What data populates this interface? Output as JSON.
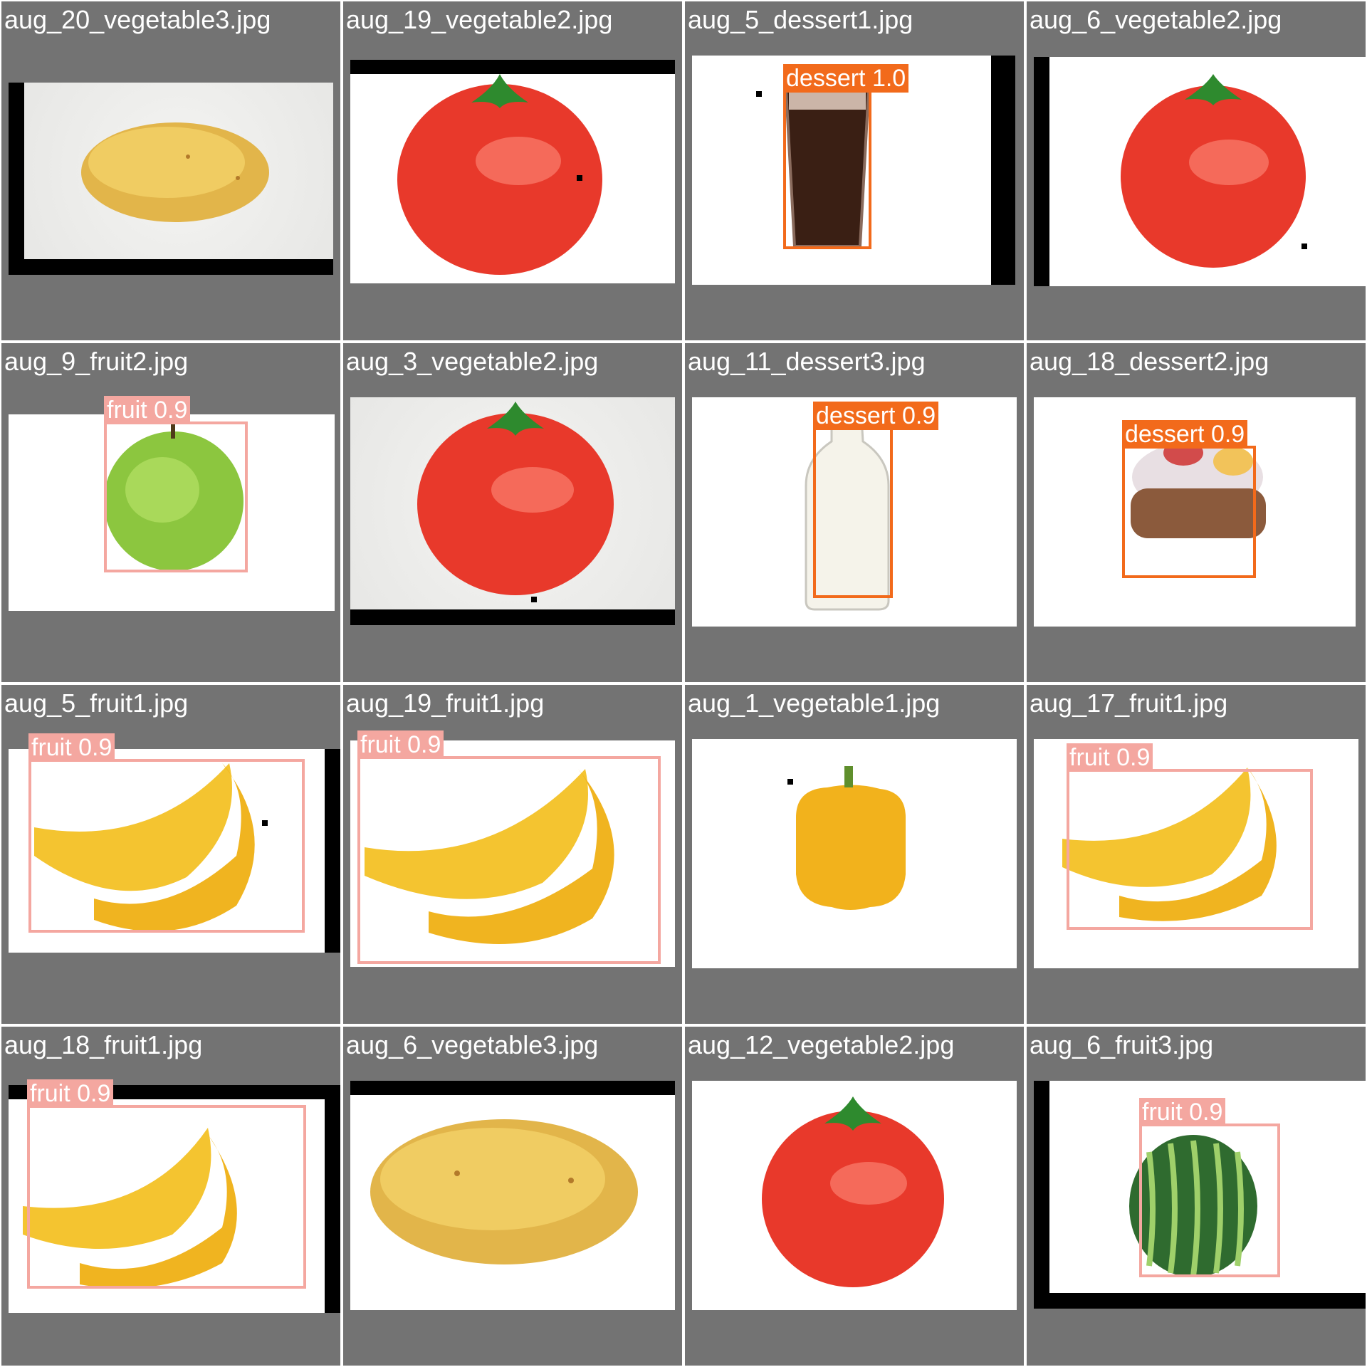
{
  "colors": {
    "panel_bg": "#737373",
    "fruit_box": "#f4a7a0",
    "dessert_box": "#f26a1b",
    "black_border": "#000000",
    "title_text": "#ffffff"
  },
  "tiles": [
    {
      "filename": "aug_20_vegetable3.jpg",
      "object": "potato",
      "detections": []
    },
    {
      "filename": "aug_19_vegetable2.jpg",
      "object": "tomato",
      "detections": []
    },
    {
      "filename": "aug_5_dessert1.jpg",
      "object": "cola-glass",
      "detections": [
        {
          "label": "dessert 1.0",
          "class": "dessert",
          "score": 1.0
        }
      ]
    },
    {
      "filename": "aug_6_vegetable2.jpg",
      "object": "tomato",
      "detections": []
    },
    {
      "filename": "aug_9_fruit2.jpg",
      "object": "green-apple",
      "detections": [
        {
          "label": "fruit 0.9",
          "class": "fruit",
          "score": 0.9
        }
      ]
    },
    {
      "filename": "aug_3_vegetable2.jpg",
      "object": "tomato",
      "detections": []
    },
    {
      "filename": "aug_11_dessert3.jpg",
      "object": "milk-bottle",
      "detections": [
        {
          "label": "dessert 0.9",
          "class": "dessert",
          "score": 0.9
        }
      ]
    },
    {
      "filename": "aug_18_dessert2.jpg",
      "object": "cupcake",
      "detections": [
        {
          "label": "dessert 0.9",
          "class": "dessert",
          "score": 0.9
        }
      ]
    },
    {
      "filename": "aug_5_fruit1.jpg",
      "object": "banana-bunch",
      "detections": [
        {
          "label": "fruit 0.9",
          "class": "fruit",
          "score": 0.9
        }
      ]
    },
    {
      "filename": "aug_19_fruit1.jpg",
      "object": "banana-bunch",
      "detections": [
        {
          "label": "fruit 0.9",
          "class": "fruit",
          "score": 0.9
        }
      ]
    },
    {
      "filename": "aug_1_vegetable1.jpg",
      "object": "yellow-pepper",
      "detections": []
    },
    {
      "filename": "aug_17_fruit1.jpg",
      "object": "banana-bunch",
      "detections": [
        {
          "label": "fruit 0.9",
          "class": "fruit",
          "score": 0.9
        }
      ]
    },
    {
      "filename": "aug_18_fruit1.jpg",
      "object": "banana-bunch",
      "detections": [
        {
          "label": "fruit 0.9",
          "class": "fruit",
          "score": 0.9
        }
      ]
    },
    {
      "filename": "aug_6_vegetable3.jpg",
      "object": "potato",
      "detections": []
    },
    {
      "filename": "aug_12_vegetable2.jpg",
      "object": "tomato",
      "detections": []
    },
    {
      "filename": "aug_6_fruit3.jpg",
      "object": "watermelon",
      "detections": [
        {
          "label": "fruit 0.9",
          "class": "fruit",
          "score": 0.9
        }
      ]
    }
  ]
}
